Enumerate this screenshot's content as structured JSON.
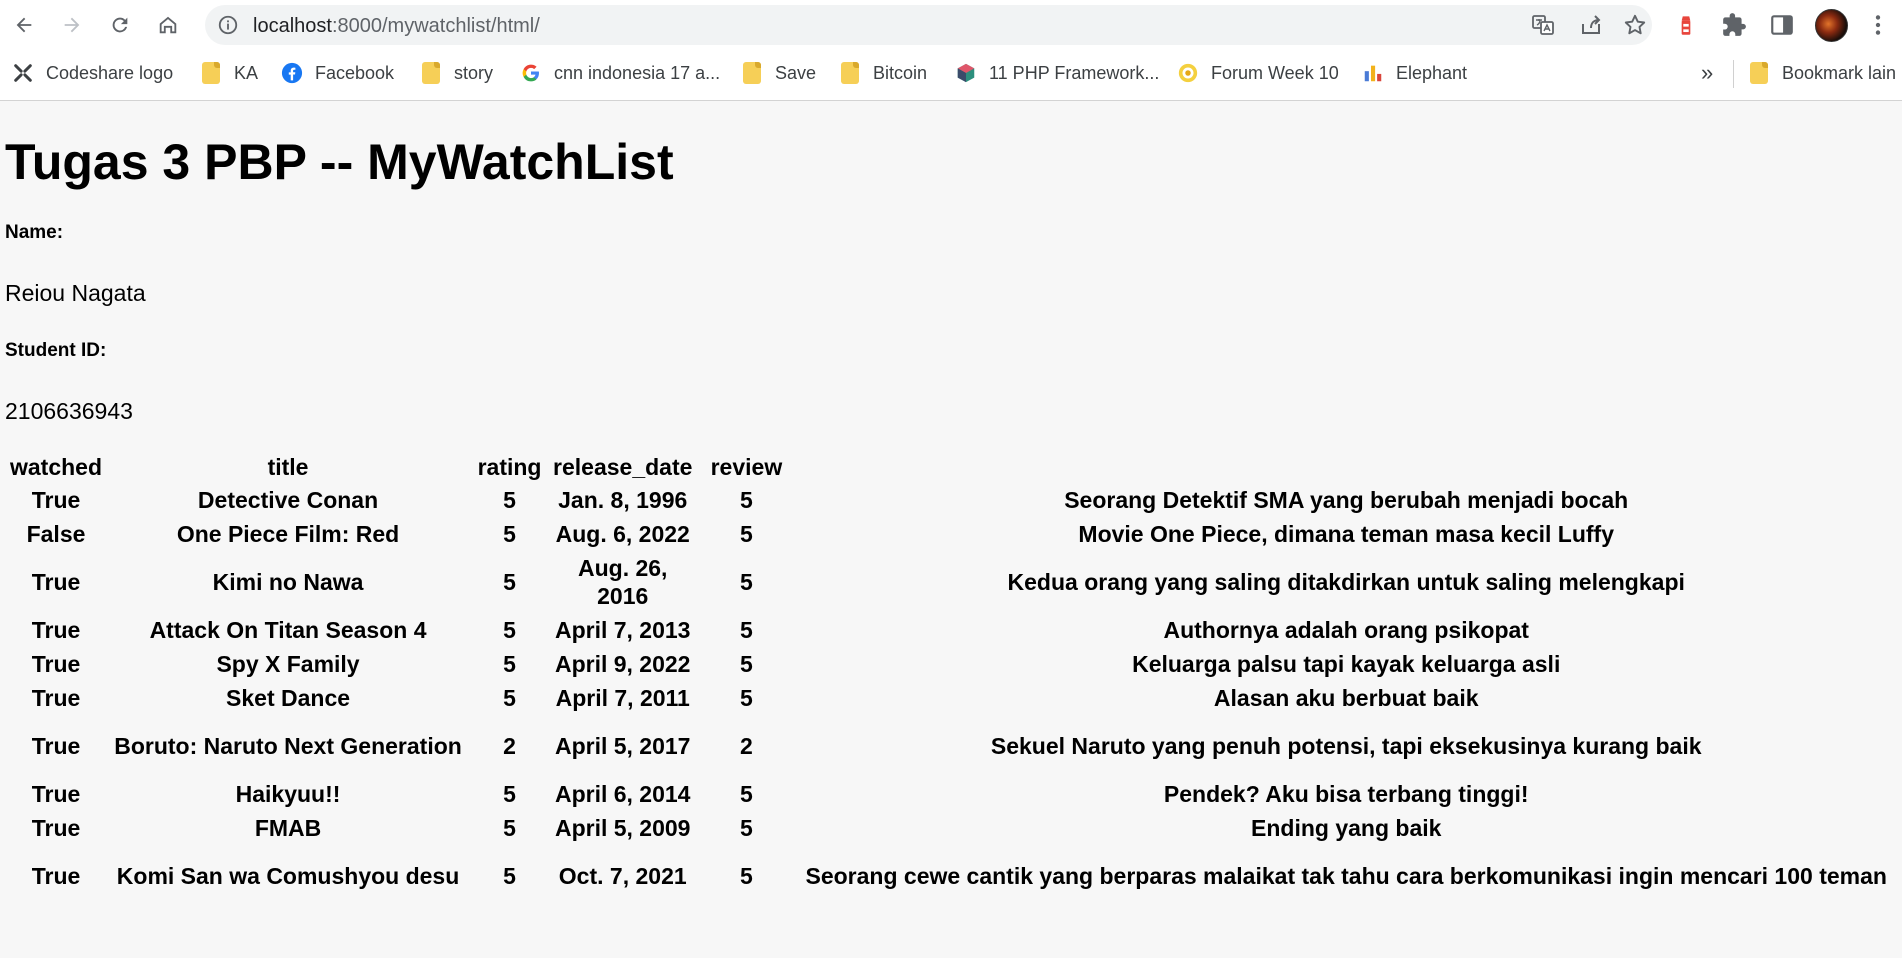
{
  "browser": {
    "url_host": "localhost",
    "url_rest": ":8000/mywatchlist/html/",
    "bookmarks": [
      {
        "label": "Codeshare logo",
        "icon": "codeshare-icon"
      },
      {
        "label": "KA",
        "icon": "folder-icon"
      },
      {
        "label": "Facebook",
        "icon": "facebook-icon"
      },
      {
        "label": "story",
        "icon": "folder-icon"
      },
      {
        "label": "cnn indonesia 17 a...",
        "icon": "google-icon"
      },
      {
        "label": "Save",
        "icon": "folder-icon"
      },
      {
        "label": "Bitcoin",
        "icon": "folder-icon"
      },
      {
        "label": "11 PHP Framework...",
        "icon": "php-icon"
      },
      {
        "label": "Forum Week 10",
        "icon": "forum-icon"
      },
      {
        "label": "Elephant",
        "icon": "chart-icon"
      }
    ],
    "overflow_label": "»",
    "other_bookmarks": "Bookmark lain"
  },
  "page": {
    "title": "Tugas 3 PBP -- MyWatchList",
    "name_label": "Name:",
    "name_value": "Reiou Nagata",
    "student_id_label": "Student ID:",
    "student_id_value": "2106636943"
  },
  "table": {
    "headers": [
      "watched",
      "title",
      "rating",
      "release_date",
      "review",
      ""
    ],
    "rows": [
      [
        "True",
        "Detective Conan",
        "5",
        "Jan. 8, 1996",
        "5",
        "Seorang Detektif SMA yang berubah menjadi bocah"
      ],
      [
        "False",
        "One Piece Film: Red",
        "5",
        "Aug. 6, 2022",
        "5",
        "Movie One Piece, dimana teman masa kecil Luffy"
      ],
      [
        "True",
        "Kimi no Nawa",
        "5",
        "Aug. 26, 2016",
        "5",
        "Kedua orang yang saling ditakdirkan untuk saling melengkapi"
      ],
      [
        "True",
        "Attack On Titan Season 4",
        "5",
        "April 7, 2013",
        "5",
        "Authornya adalah orang psikopat"
      ],
      [
        "True",
        "Spy X Family",
        "5",
        "April 9, 2022",
        "5",
        "Keluarga palsu tapi kayak keluarga asli"
      ],
      [
        "True",
        "Sket Dance",
        "5",
        "April 7, 2011",
        "5",
        "Alasan aku berbuat baik"
      ],
      [
        "True",
        "Boruto: Naruto Next Generation",
        "2",
        "April 5, 2017",
        "2",
        "Sekuel Naruto yang penuh potensi, tapi eksekusinya kurang baik"
      ],
      [
        "True",
        "Haikyuu!!",
        "5",
        "April 6, 2014",
        "5",
        "Pendek? Aku bisa terbang tinggi!"
      ],
      [
        "True",
        "FMAB",
        "5",
        "April 5, 2009",
        "5",
        "Ending yang baik"
      ],
      [
        "True",
        "Komi San wa Comushyou desu",
        "5",
        "Oct. 7, 2021",
        "5",
        "Seorang cewe cantik yang berparas malaikat tak tahu cara berkomunikasi ingin mencari 100 teman"
      ]
    ]
  }
}
